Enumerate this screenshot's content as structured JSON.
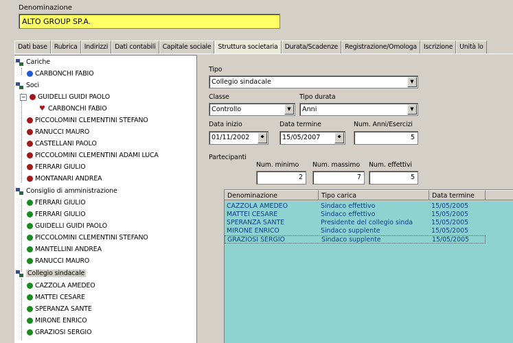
{
  "header": {
    "denominazione_label": "Denominazione",
    "denominazione_value": "ALTO GROUP SP.A."
  },
  "tabs": [
    {
      "label": "Dati base"
    },
    {
      "label": "Rubrica"
    },
    {
      "label": "Indirizzi"
    },
    {
      "label": "Dati contabili"
    },
    {
      "label": "Capitale sociale"
    },
    {
      "label": "Struttura societaria"
    },
    {
      "label": "Durata/Scadenze"
    },
    {
      "label": "Registrazione/Omologa"
    },
    {
      "label": "Iscrizione"
    },
    {
      "label": "Unità lo"
    }
  ],
  "active_tab": "Struttura societaria",
  "tree": {
    "cariche": {
      "label": "Cariche",
      "items": [
        "CARBONCHI FABIO"
      ]
    },
    "soci": {
      "label": "Soci",
      "expanded_item": "GUIDELLI GUIDI PAOLO",
      "expanded_child": "CARBONCHI FABIO",
      "items": [
        "PICCOLOMINI CLEMENTINI STEFANO",
        "RANUCCI MAURO",
        "CASTELLANI PAOLO",
        "PICCOLOMINI CLEMENTINI ADAMI LUCA",
        "FERRARI GIULIO",
        "MONTANARI ANDREA"
      ]
    },
    "consiglio": {
      "label": "Consiglio di amministrazione",
      "items": [
        "FERRARI GIULIO",
        "FERRARI GIULIO",
        "GUIDELLI GUIDI PAOLO",
        "PICCOLOMINI CLEMENTINI STEFANO",
        "MANTELLINI ANDREA",
        "RANUCCI MAURO"
      ]
    },
    "collegio": {
      "label": "Collegio sindacale",
      "items": [
        "CAZZOLA AMEDEO",
        "MATTEI CESARE",
        "SPERANZA SANTE",
        "MIRONE ENRICO",
        "GRAZIOSI SERGIO"
      ]
    }
  },
  "form": {
    "tipo_label": "Tipo",
    "tipo_value": "Collegio sindacale",
    "classe_label": "Classe",
    "classe_value": "Controllo",
    "tipo_durata_label": "Tipo durata",
    "tipo_durata_value": "Anni",
    "data_inizio_label": "Data inizio",
    "data_inizio_value": "01/11/2002",
    "data_termine_label": "Data termine",
    "data_termine_value": "15/05/2007",
    "num_anni_label": "Num. Anni/Esercizi",
    "num_anni_value": "5",
    "partecipanti_label": "Partecipanti",
    "num_minimo_label": "Num. minimo",
    "num_minimo_value": "2",
    "num_massimo_label": "Num. massimo",
    "num_massimo_value": "7",
    "num_effettivi_label": "Num. effettivi",
    "num_effettivi_value": "5"
  },
  "grid": {
    "columns": [
      "Denominazione",
      "Tipo carica",
      "Data termine"
    ],
    "rows": [
      [
        "CAZZOLA AMEDEO",
        "Sindaco effettivo",
        "15/05/2005"
      ],
      [
        "MATTEI CESARE",
        "Sindaco effettivo",
        "15/05/2005"
      ],
      [
        "SPERANZA SANTE",
        "Presidente del collegio sinda",
        "15/05/2005"
      ],
      [
        "MIRONE ENRICO",
        "Sindaco supplente",
        "15/05/2005"
      ],
      [
        "GRAZIOSI SERGIO",
        "Sindaco supplente",
        "15/05/2005"
      ]
    ]
  },
  "colors": {
    "yellow_field": "#ffff66",
    "grid_bg": "#8fd3d1",
    "grid_text": "#0a3d8a",
    "window_bg": "#d4d0c8"
  }
}
